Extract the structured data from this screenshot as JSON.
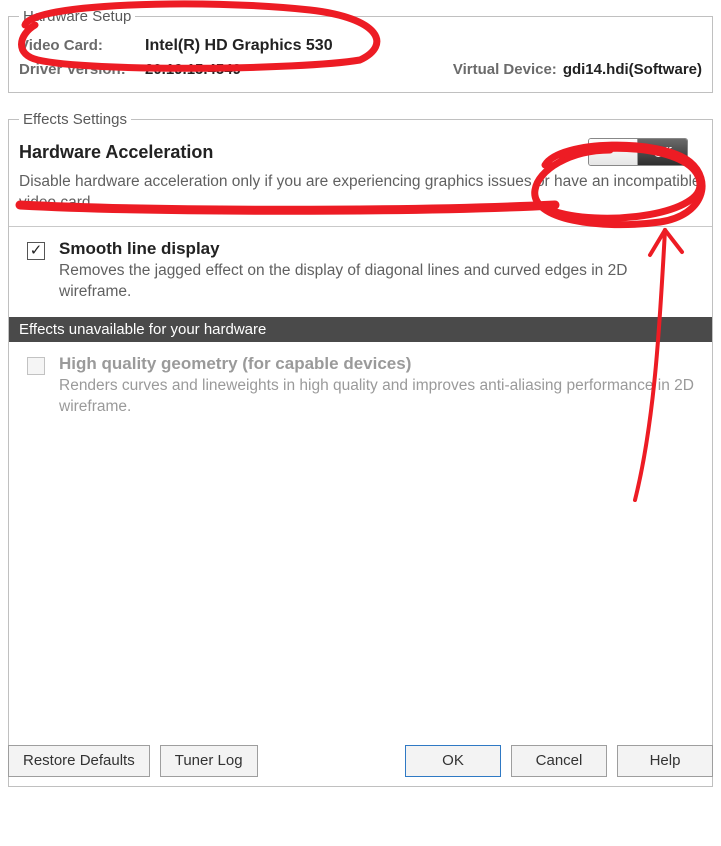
{
  "hardware_setup": {
    "legend": "Hardware Setup",
    "video_card_label": "Video Card:",
    "video_card_value": "Intel(R) HD Graphics 530",
    "driver_version_label": "Driver Version:",
    "driver_version_value": "20.19.15.4549",
    "virtual_device_label": "Virtual Device:",
    "virtual_device_value": "gdi14.hdi(Software)"
  },
  "effects": {
    "legend": "Effects Settings",
    "hw_accel_title": "Hardware Acceleration",
    "hw_accel_state": "Off",
    "hw_accel_desc": "Disable hardware acceleration only if you are experiencing graphics issues or have an incompatible video card.",
    "smooth_line_title": "Smooth line display",
    "smooth_line_desc": "Removes the jagged effect on the display of diagonal lines and curved edges in 2D wireframe.",
    "unavailable_header": "Effects unavailable for your hardware",
    "hq_geom_title": "High quality geometry (for capable devices)",
    "hq_geom_desc": "Renders curves and lineweights in high quality and improves anti-aliasing performance in 2D wireframe."
  },
  "buttons": {
    "restore_defaults": "Restore Defaults",
    "tuner_log": "Tuner Log",
    "ok": "OK",
    "cancel": "Cancel",
    "help": "Help"
  },
  "annotation_color": "#ed1c24"
}
